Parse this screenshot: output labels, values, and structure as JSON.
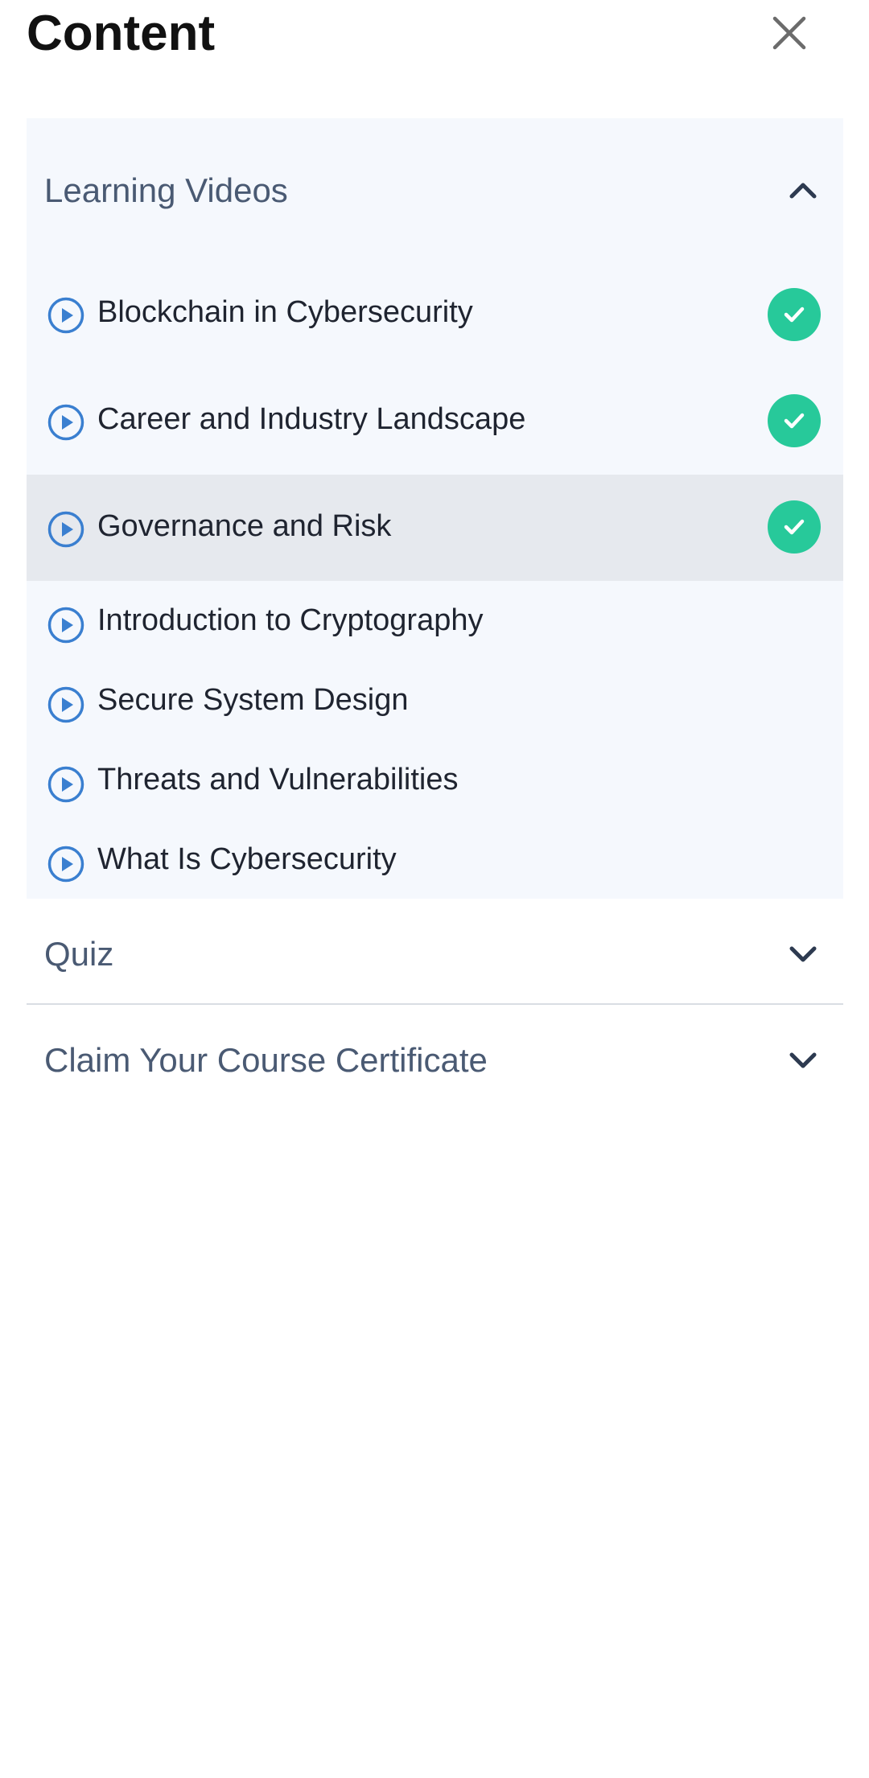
{
  "header": {
    "title": "Content",
    "close_icon": "close-icon"
  },
  "sections": [
    {
      "title": "Learning Videos",
      "expanded": true,
      "toggle_icon": "chevron-up-icon",
      "items": [
        {
          "label": "Blockchain in Cybersecurity",
          "completed": true,
          "active": false,
          "icon": "play-circle-icon"
        },
        {
          "label": "Career and Industry Landscape",
          "completed": true,
          "active": false,
          "icon": "play-circle-icon"
        },
        {
          "label": "Governance and Risk",
          "completed": true,
          "active": true,
          "icon": "play-circle-icon"
        },
        {
          "label": "Introduction to Cryptography",
          "completed": false,
          "active": false,
          "icon": "play-circle-icon"
        },
        {
          "label": "Secure System Design",
          "completed": false,
          "active": false,
          "icon": "play-circle-icon"
        },
        {
          "label": "Threats and Vulnerabilities",
          "completed": false,
          "active": false,
          "icon": "play-circle-icon"
        },
        {
          "label": "What Is Cybersecurity",
          "completed": false,
          "active": false,
          "icon": "play-circle-icon"
        }
      ]
    },
    {
      "title": "Quiz",
      "expanded": false,
      "toggle_icon": "chevron-down-icon"
    },
    {
      "title": "Claim Your Course Certificate",
      "expanded": false,
      "toggle_icon": "chevron-down-icon"
    }
  ],
  "colors": {
    "panel_bg": "#f5f8fd",
    "active_row_bg": "#e6e9ee",
    "check_green": "#27c99a",
    "play_blue": "#3a7fd0",
    "section_title": "#4a5a73",
    "chevron": "#2d3a50"
  }
}
